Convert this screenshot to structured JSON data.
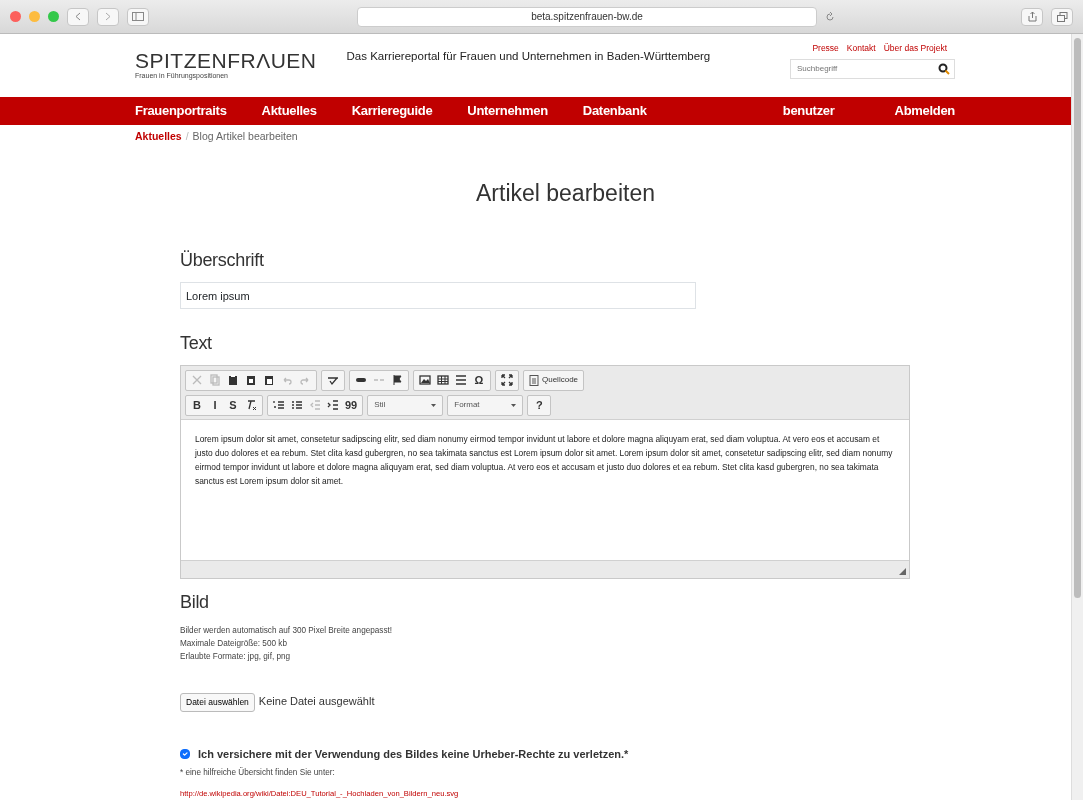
{
  "browser": {
    "url": "beta.spitzenfrauen-bw.de"
  },
  "header": {
    "logo_title": "SPITZENFRΛUEN",
    "logo_subtitle": "Frauen in Führungspositionen",
    "tagline": "Das Karriereportal für Frauen und Unternehmen in Baden-Württemberg",
    "top_links": [
      "Presse",
      "Kontakt",
      "Über das Projekt"
    ],
    "search": {
      "placeholder": "Suchbegriff"
    }
  },
  "nav": {
    "left": [
      "Frauenportraits",
      "Aktuelles",
      "Karriereguide",
      "Unternehmen",
      "Datenbank"
    ],
    "right": [
      "benutzer",
      "Abmelden"
    ]
  },
  "breadcrumb": {
    "separator": "/",
    "items": [
      {
        "label": "Aktuelles",
        "link": true
      },
      {
        "label": "Blog Artikel bearbeiten",
        "link": false
      }
    ]
  },
  "page_title": "Artikel bearbeiten",
  "heading_field": {
    "label": "Überschrift",
    "value": "Lorem ipsum"
  },
  "text_field": {
    "label": "Text",
    "toolbar": [
      [
        [
          {
            "kind": "icon",
            "disabled": true
          },
          {
            "kind": "icon",
            "disabled": true
          },
          {
            "kind": "icon",
            "disabled": false
          },
          {
            "kind": "icon",
            "disabled": false
          },
          {
            "kind": "icon",
            "disabled": false
          },
          {
            "kind": "icon",
            "disabled": true
          },
          {
            "kind": "icon",
            "disabled": true
          }
        ],
        [
          {
            "kind": "icon",
            "disabled": false
          }
        ],
        [
          {
            "kind": "icon",
            "disabled": false
          },
          {
            "kind": "icon",
            "disabled": true
          },
          {
            "kind": "icon",
            "disabled": false
          }
        ],
        [
          {
            "kind": "icon",
            "disabled": false
          },
          {
            "kind": "icon",
            "disabled": false
          },
          {
            "kind": "icon",
            "disabled": false
          },
          {
            "kind": "text",
            "label": "Ω",
            "disabled": false
          }
        ],
        [
          {
            "kind": "icon",
            "disabled": false
          }
        ],
        [
          {
            "kind": "source",
            "label": "Quellcode",
            "disabled": false
          }
        ]
      ],
      [
        [
          {
            "kind": "text",
            "label": "B",
            "disabled": false
          },
          {
            "kind": "text",
            "label": "I",
            "disabled": false
          },
          {
            "kind": "text",
            "label": "S",
            "disabled": false
          },
          {
            "kind": "icon",
            "disabled": false
          }
        ],
        [
          {
            "kind": "icon",
            "disabled": false
          },
          {
            "kind": "icon",
            "disabled": false
          },
          {
            "kind": "icon",
            "disabled": true
          },
          {
            "kind": "icon",
            "disabled": false
          },
          {
            "kind": "text",
            "label": "99",
            "disabled": false
          }
        ],
        [
          {
            "kind": "dropdown",
            "label": "Stil",
            "disabled": false
          }
        ],
        [
          {
            "kind": "dropdown",
            "label": "Format",
            "disabled": false
          }
        ],
        [
          {
            "kind": "text",
            "label": "?",
            "disabled": false
          }
        ]
      ]
    ],
    "content": "Lorem ipsum dolor sit amet, consetetur sadipscing elitr, sed diam nonumy eirmod tempor invidunt ut labore et dolore magna aliquyam erat, sed diam voluptua. At vero eos et accusam et justo duo dolores et ea rebum. Stet clita kasd gubergren, no sea takimata sanctus est Lorem ipsum dolor sit amet. Lorem ipsum dolor sit amet, consetetur sadipscing elitr, sed diam nonumy eirmod tempor invidunt ut labore et dolore magna aliquyam erat, sed diam voluptua. At vero eos et accusam et justo duo dolores et ea rebum. Stet clita kasd gubergren, no sea takimata sanctus est Lorem ipsum dolor sit amet."
  },
  "image_field": {
    "label": "Bild",
    "notes": [
      "Bilder werden automatisch auf 300 Pixel Breite angepasst!",
      "Maximale Dateigröße: 500 kb",
      "Erlaubte Formate: jpg, gif, png"
    ],
    "file_button": "Datei auswählen",
    "file_status": "Keine Datei ausgewählt"
  },
  "consent": {
    "label": "Ich versichere mit der Verwendung des Bildes keine Urheber-Rechte zu verletzen.*",
    "checked": true,
    "footnote": "* eine hilfreiche Übersicht finden Sie unter:",
    "link": "http://de.wikipedia.org/wiki/Datei:DEU_Tutorial_-_Hochladen_von_Bildern_neu.svg"
  }
}
